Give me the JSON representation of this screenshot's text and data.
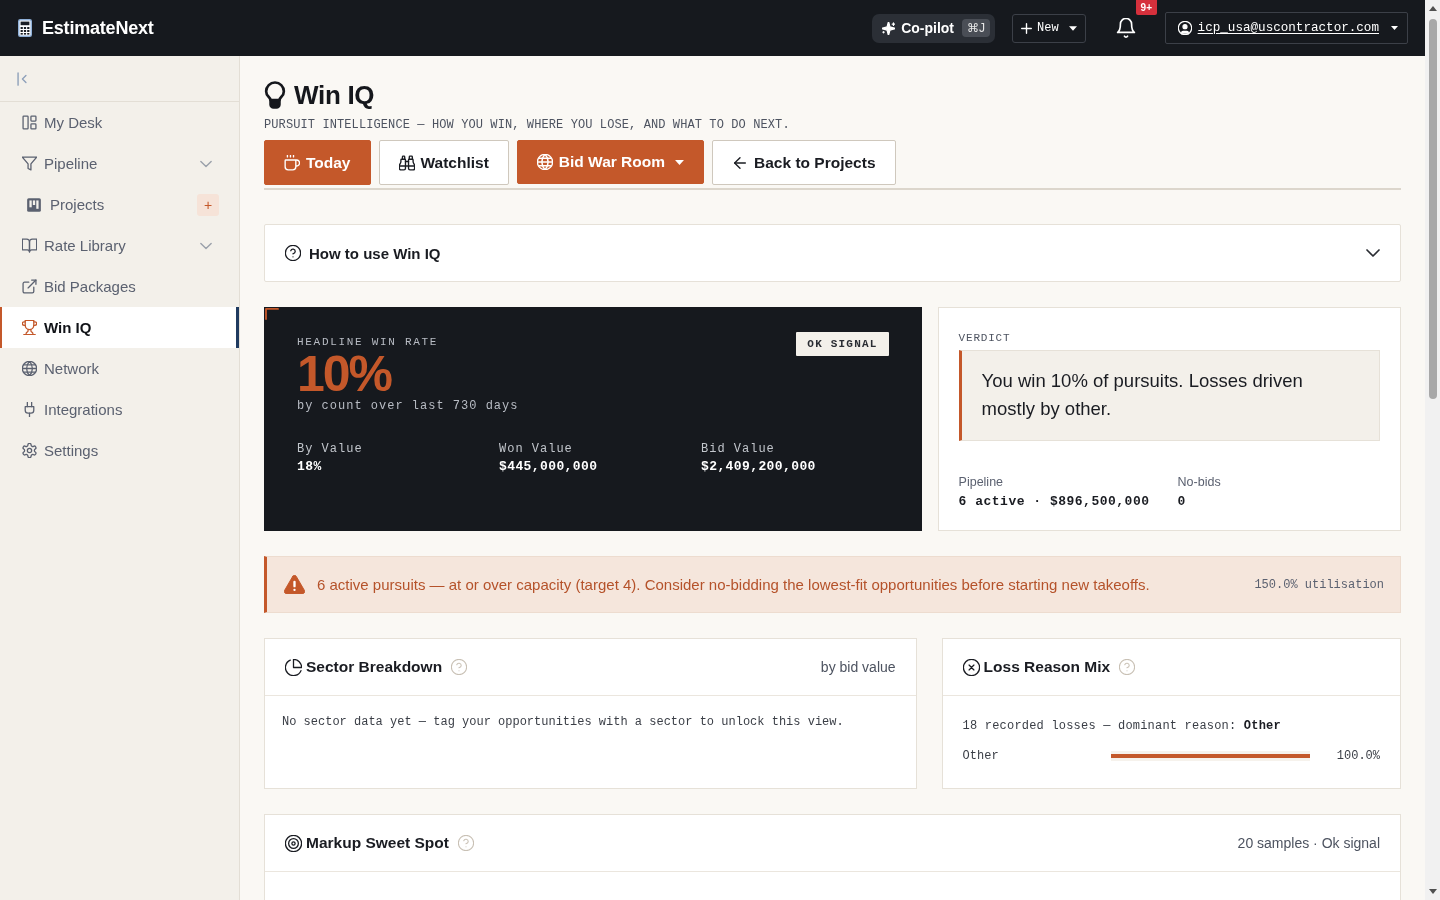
{
  "topbar": {
    "brand": "EstimateNext",
    "copilot": {
      "label": "Co-pilot",
      "shortcut": "⌘J"
    },
    "new_button": {
      "label": "New"
    },
    "notifications": {
      "badge": "9+"
    },
    "account": {
      "email": "icp_usa@uscontractor.com"
    }
  },
  "sidebar": {
    "items": [
      {
        "label": "My Desk",
        "kind": "link",
        "selected": false
      },
      {
        "label": "Pipeline",
        "kind": "group",
        "selected": false
      },
      {
        "label": "Projects",
        "kind": "sub",
        "action": "+",
        "selected": false
      },
      {
        "label": "Rate Library",
        "kind": "group",
        "selected": false
      },
      {
        "label": "Bid Packages",
        "kind": "link",
        "selected": false
      },
      {
        "label": "Win IQ",
        "kind": "link",
        "selected": true
      },
      {
        "label": "Network",
        "kind": "link",
        "selected": false
      },
      {
        "label": "Integrations",
        "kind": "link",
        "selected": false
      },
      {
        "label": "Settings",
        "kind": "link",
        "selected": false
      }
    ]
  },
  "page_header": {
    "title": "Win IQ",
    "subtitle": "PURSUIT INTELLIGENCE — HOW YOU WIN, WHERE YOU LOSE, AND WHAT TO DO NEXT.",
    "actions": [
      {
        "label": "Today",
        "kind": "primary",
        "dropdown": false
      },
      {
        "label": "Watchlist",
        "kind": "outline",
        "dropdown": false
      },
      {
        "label": "Bid War Room",
        "kind": "primary",
        "dropdown": true
      },
      {
        "label": "Back to Projects",
        "kind": "outline",
        "dropdown": false
      }
    ]
  },
  "help_panel": {
    "title": "How to use Win IQ",
    "expanded": false
  },
  "headline": {
    "label": "HEADLINE WIN RATE",
    "value": "10%",
    "caption": "by count over last 730 days",
    "badge": "OK SIGNAL",
    "stats": [
      {
        "label": "By Value",
        "value": "18%"
      },
      {
        "label": "Won Value",
        "value": "$445,000,000"
      },
      {
        "label": "Bid Value",
        "value": "$2,409,200,000"
      }
    ]
  },
  "verdict": {
    "label": "VERDICT",
    "text": "You win 10% of pursuits. Losses driven mostly by other.",
    "stats": [
      {
        "label": "Pipeline",
        "value": "6 active · $896,500,000"
      },
      {
        "label": "No-bids",
        "value": "0"
      }
    ]
  },
  "alert": {
    "kind": "warning",
    "text": "6 active pursuits — at or over capacity (target 4). Consider no-bidding the lowest-fit opportunities before starting new takeoffs.",
    "meta": "150.0% utilisation"
  },
  "sector_breakdown": {
    "title": "Sector Breakdown",
    "meta": "by bid value",
    "message": "No sector data yet — tag your opportunities with a sector to unlock this view."
  },
  "loss_reason_mix": {
    "title": "Loss Reason Mix",
    "summary": "18 recorded losses — dominant reason: **Other**",
    "reasons": [
      {
        "label": "Other",
        "level": 1,
        "reading": "100.0%"
      }
    ]
  },
  "markup_sweet_spot": {
    "title": "Markup Sweet Spot",
    "meta": "20 samples · Ok signal"
  }
}
